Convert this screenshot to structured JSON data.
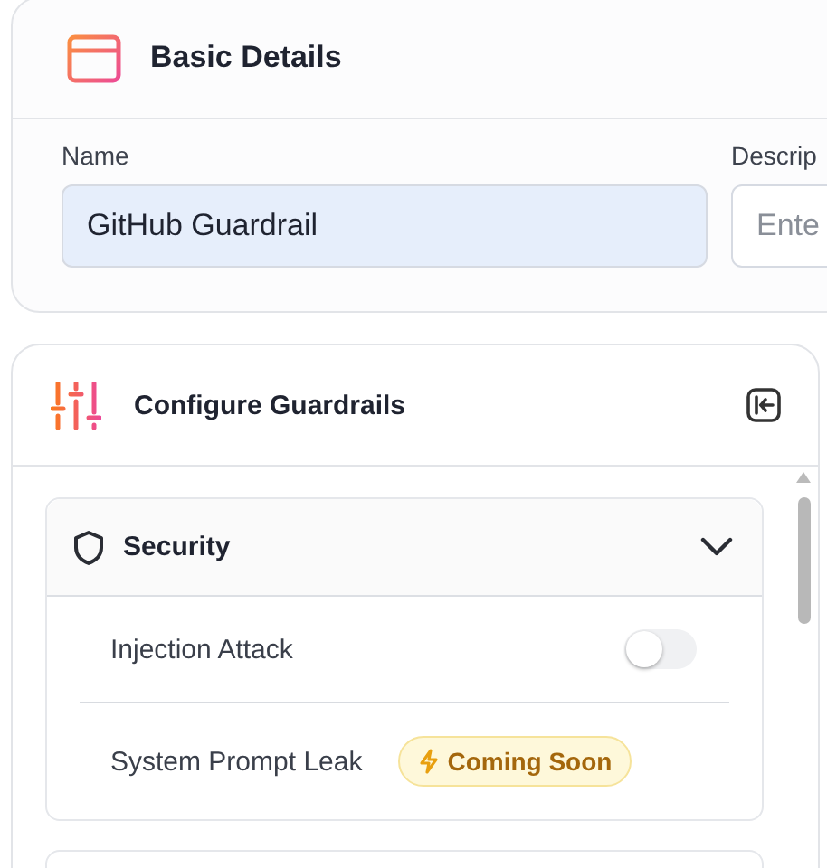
{
  "basic_details": {
    "title": "Basic Details",
    "fields": [
      {
        "label": "Name",
        "value": "GitHub Guardrail"
      },
      {
        "label": "Descrip",
        "placeholder": "Ente"
      }
    ]
  },
  "guardrails": {
    "title": "Configure Guardrails",
    "sections": [
      {
        "title": "Security",
        "expanded": true,
        "items": [
          {
            "kind": "toggle",
            "label": "Injection Attack",
            "on": false
          },
          {
            "kind": "badge",
            "label": "System Prompt Leak",
            "badge": "Coming Soon"
          }
        ]
      }
    ]
  }
}
